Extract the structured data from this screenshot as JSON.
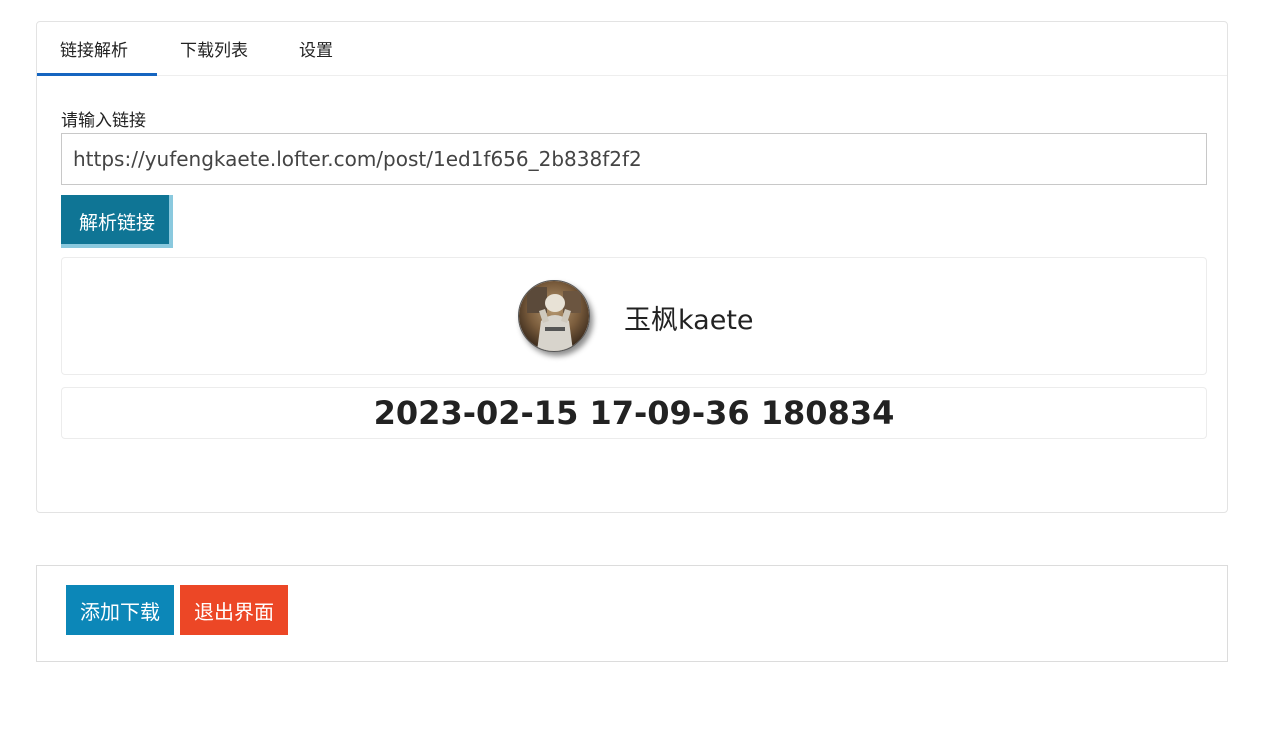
{
  "tabs": [
    {
      "label": "链接解析",
      "active": true
    },
    {
      "label": "下载列表",
      "active": false
    },
    {
      "label": "设置",
      "active": false
    }
  ],
  "link_form": {
    "label": "请输入链接",
    "value": "https://yufengkaete.lofter.com/post/1ed1f656_2b838f2f2",
    "parse_button": "解析链接"
  },
  "result": {
    "username": "玉枫kaete",
    "post_time": "2023-02-15 17-09-36 180834"
  },
  "actions": {
    "add_download": "添加下载",
    "exit": "退出界面"
  },
  "colors": {
    "tab_active_underline": "#1565c0",
    "parse_button": "#0f7595",
    "add_button": "#0c87b8",
    "exit_button": "#ec4726"
  }
}
